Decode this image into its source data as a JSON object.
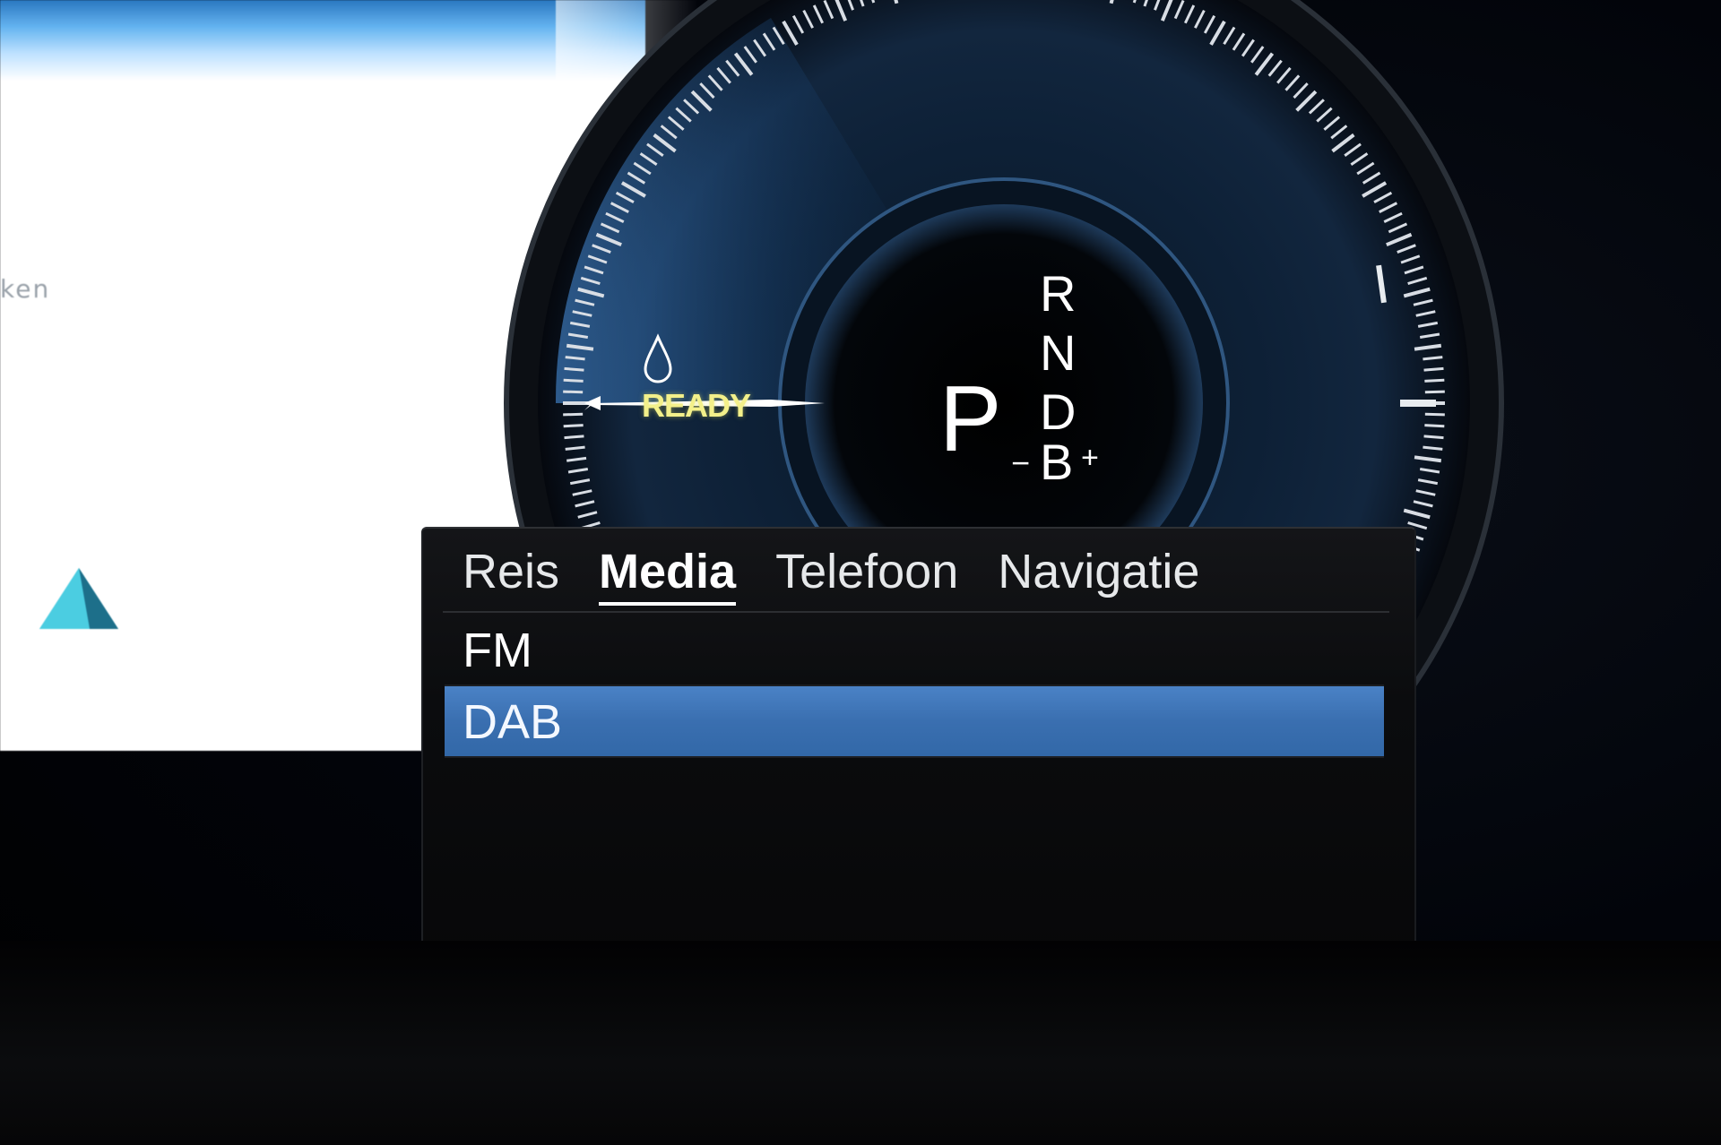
{
  "left_screen": {
    "partial_text": "ken"
  },
  "status": {
    "ready_label": "READY",
    "ready_color": "#f3f08a"
  },
  "gear_selector": {
    "current": "P",
    "options": [
      "R",
      "N",
      "D",
      "B"
    ],
    "b_minus": "−",
    "b_plus": "+"
  },
  "menu": {
    "tabs": [
      {
        "label": "Reis",
        "active": false
      },
      {
        "label": "Media",
        "active": true
      },
      {
        "label": "Telefoon",
        "active": false
      },
      {
        "label": "Navigatie",
        "active": false
      }
    ],
    "items": [
      {
        "label": "FM",
        "selected": false
      },
      {
        "label": "DAB",
        "selected": true
      }
    ],
    "selected_color": "#3a6fb0"
  },
  "icons": {
    "drop": "drop-icon",
    "pyramid": "pyramid-icon"
  }
}
